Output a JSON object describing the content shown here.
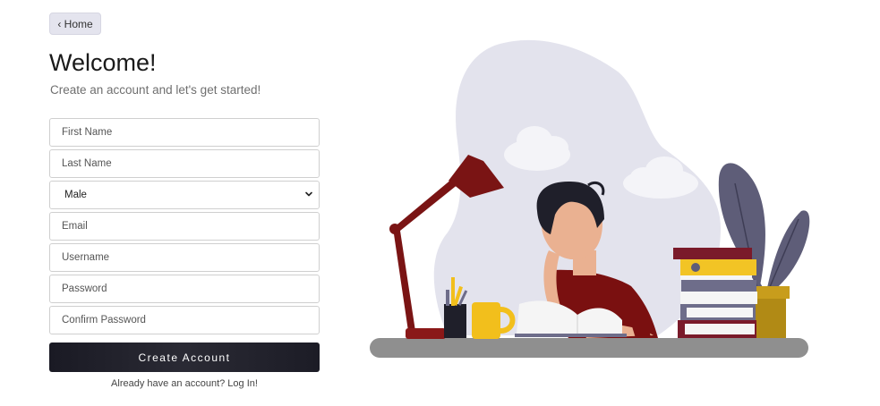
{
  "nav": {
    "home_label": "‹ Home"
  },
  "header": {
    "title": "Welcome!",
    "subtitle": "Create an account and let's get started!"
  },
  "form": {
    "first_name_placeholder": "First Name",
    "last_name_placeholder": "Last Name",
    "gender_selected": "Male",
    "email_placeholder": "Email",
    "username_placeholder": "Username",
    "password_placeholder": "Password",
    "confirm_password_placeholder": "Confirm Password",
    "submit_label": "Create Account",
    "login_text": "Already have an account? Log In!"
  },
  "illustration": {
    "subject": "student-reading-at-desk",
    "colors": {
      "blob": "#e3e3ed",
      "lamp": "#7a1414",
      "shirt": "#7a1010",
      "hair": "#1f1f2a",
      "skin": "#eab191",
      "mug": "#f2bf1c",
      "plant_leaf": "#5e5d78",
      "pot": "#b18a15",
      "desk": "#8f8f8f"
    }
  }
}
